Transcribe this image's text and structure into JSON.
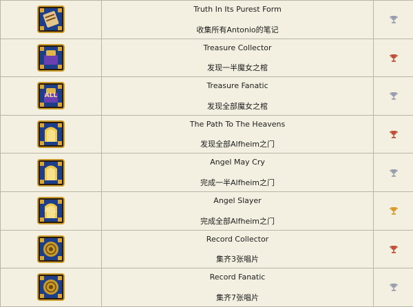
{
  "trophies": [
    {
      "title": "Truth In Its Purest Form",
      "desc": "收集所有Antonio的笔记",
      "icon": "scroll-icon",
      "grade": "silver",
      "cup_color": "#9a9fb0"
    },
    {
      "title": "Treasure Collector",
      "desc": "发现一半魔女之棺",
      "icon": "coffin-icon",
      "grade": "bronze",
      "cup_color": "#c0503a"
    },
    {
      "title": "Treasure Fanatic",
      "desc": "发现全部魔女之棺",
      "icon": "coffin-all-icon",
      "grade": "silver",
      "cup_color": "#9a9fb0"
    },
    {
      "title": "The Path To The Heavens",
      "desc": "发现全部Alfheim之门",
      "icon": "gate-icon",
      "grade": "bronze",
      "cup_color": "#c0503a"
    },
    {
      "title": "Angel May Cry",
      "desc": "完成一半Alfheim之门",
      "icon": "gate-icon",
      "grade": "silver",
      "cup_color": "#9a9fb0"
    },
    {
      "title": "Angel Slayer",
      "desc": "完成全部Alfheim之门",
      "icon": "gate-all-icon",
      "grade": "gold",
      "cup_color": "#d99a2b"
    },
    {
      "title": "Record Collector",
      "desc": "集齐3张唱片",
      "icon": "record-icon",
      "grade": "bronze",
      "cup_color": "#c0503a"
    },
    {
      "title": "Record Fanatic",
      "desc": "集齐7张唱片",
      "icon": "record-icon",
      "grade": "silver",
      "cup_color": "#9a9fb0"
    }
  ],
  "all_label": "ALL"
}
